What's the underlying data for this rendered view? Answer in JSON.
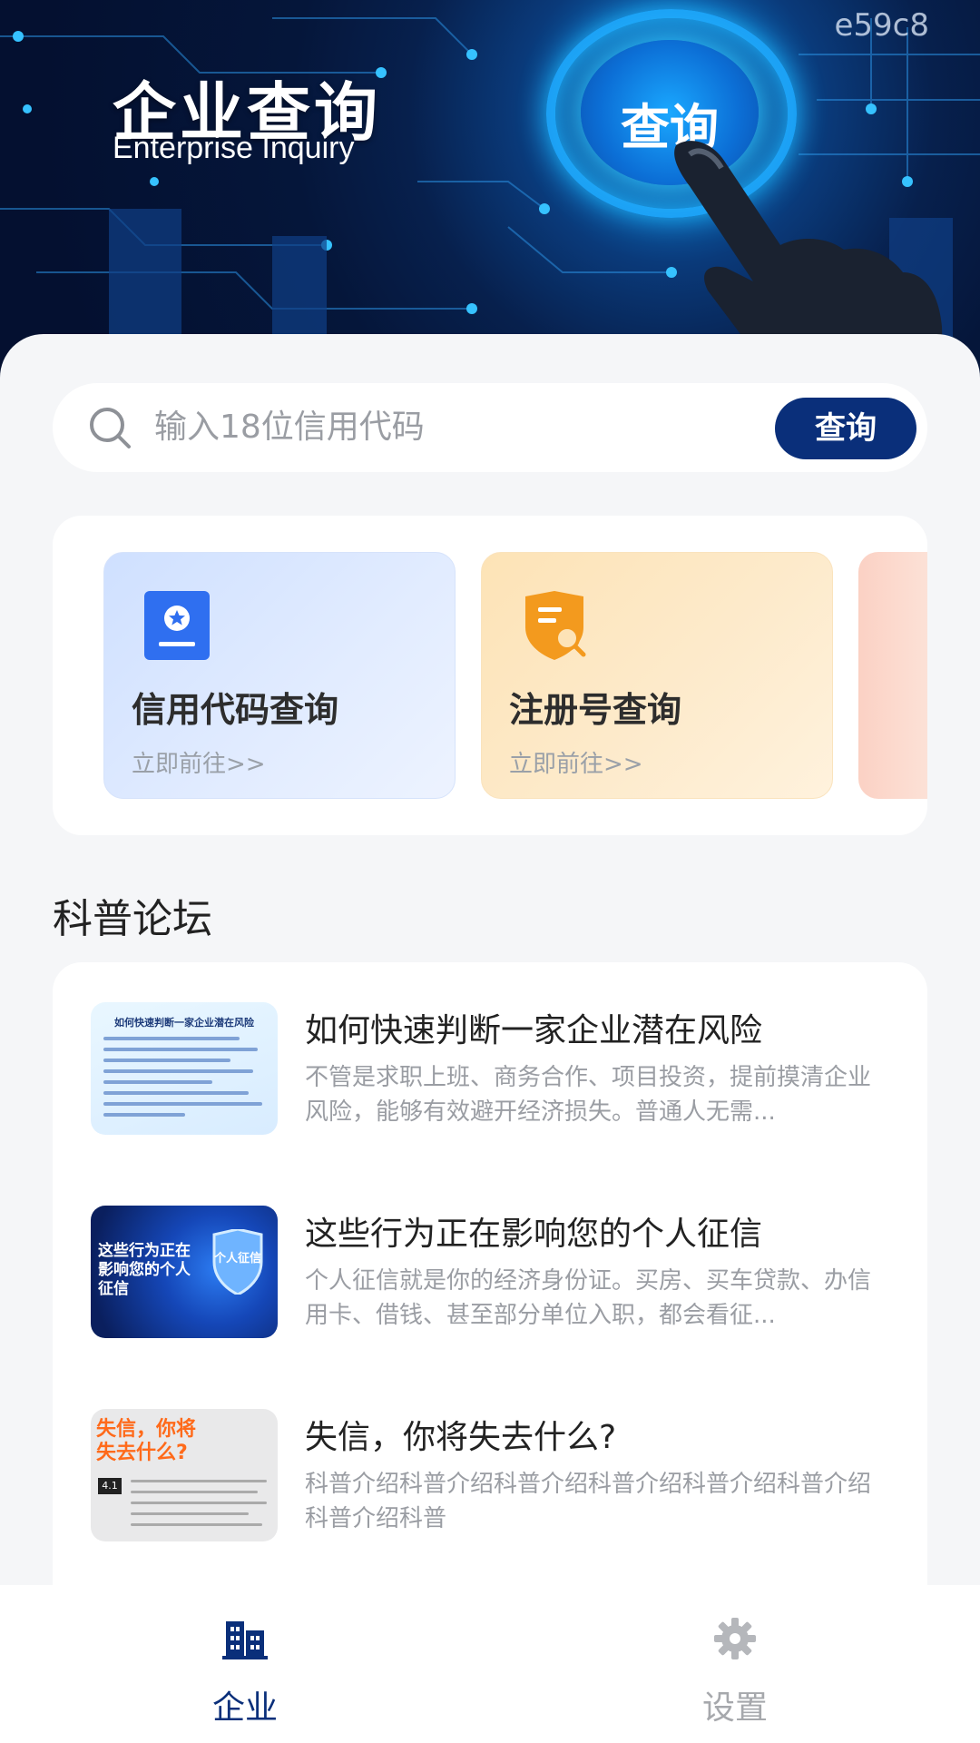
{
  "banner": {
    "code_tag": "e59c8",
    "title": "企业查询",
    "subtitle": "Enterprise Inquiry",
    "orb_label": "查询"
  },
  "search": {
    "placeholder": "输入18位信用代码",
    "button_label": "查询"
  },
  "quick_cards": [
    {
      "title": "信用代码查询",
      "link": "立即前往>>",
      "icon": "credit-code-icon",
      "color": "#2f6ff0"
    },
    {
      "title": "注册号查询",
      "link": "立即前往>>",
      "icon": "shield-search-icon",
      "color": "#f39a1e"
    }
  ],
  "forum": {
    "title": "科普论坛",
    "articles": [
      {
        "title": "如何快速判断一家企业潜在风险",
        "desc": "不管是求职上班、商务合作、项目投资，提前摸清企业风险，能够有效避开经济损失。普通人无需...",
        "thumb_text": "如何快速判断一家企业潜在风险"
      },
      {
        "title": "这些行为正在影响您的个人征信",
        "desc": "个人征信就是你的经济身份证。买房、买车贷款、办信用卡、借钱、甚至部分单位入职，都会看征...",
        "thumb_text": "这些行为正在影响您的个人征信",
        "thumb_badge": "个人征信"
      },
      {
        "title": "失信，你将失去什么?",
        "desc": "科普介绍科普介绍科普介绍科普介绍科普介绍科普介绍科普介绍科普",
        "thumb_text": "失信，你将失去什么?",
        "thumb_badge": "4.1"
      }
    ]
  },
  "nav": {
    "items": [
      {
        "label": "企业",
        "icon": "building-icon",
        "active": true
      },
      {
        "label": "设置",
        "icon": "gear-icon",
        "active": false
      }
    ]
  },
  "colors": {
    "primary": "#0a2f7a",
    "inactive": "#a6a8ac"
  }
}
